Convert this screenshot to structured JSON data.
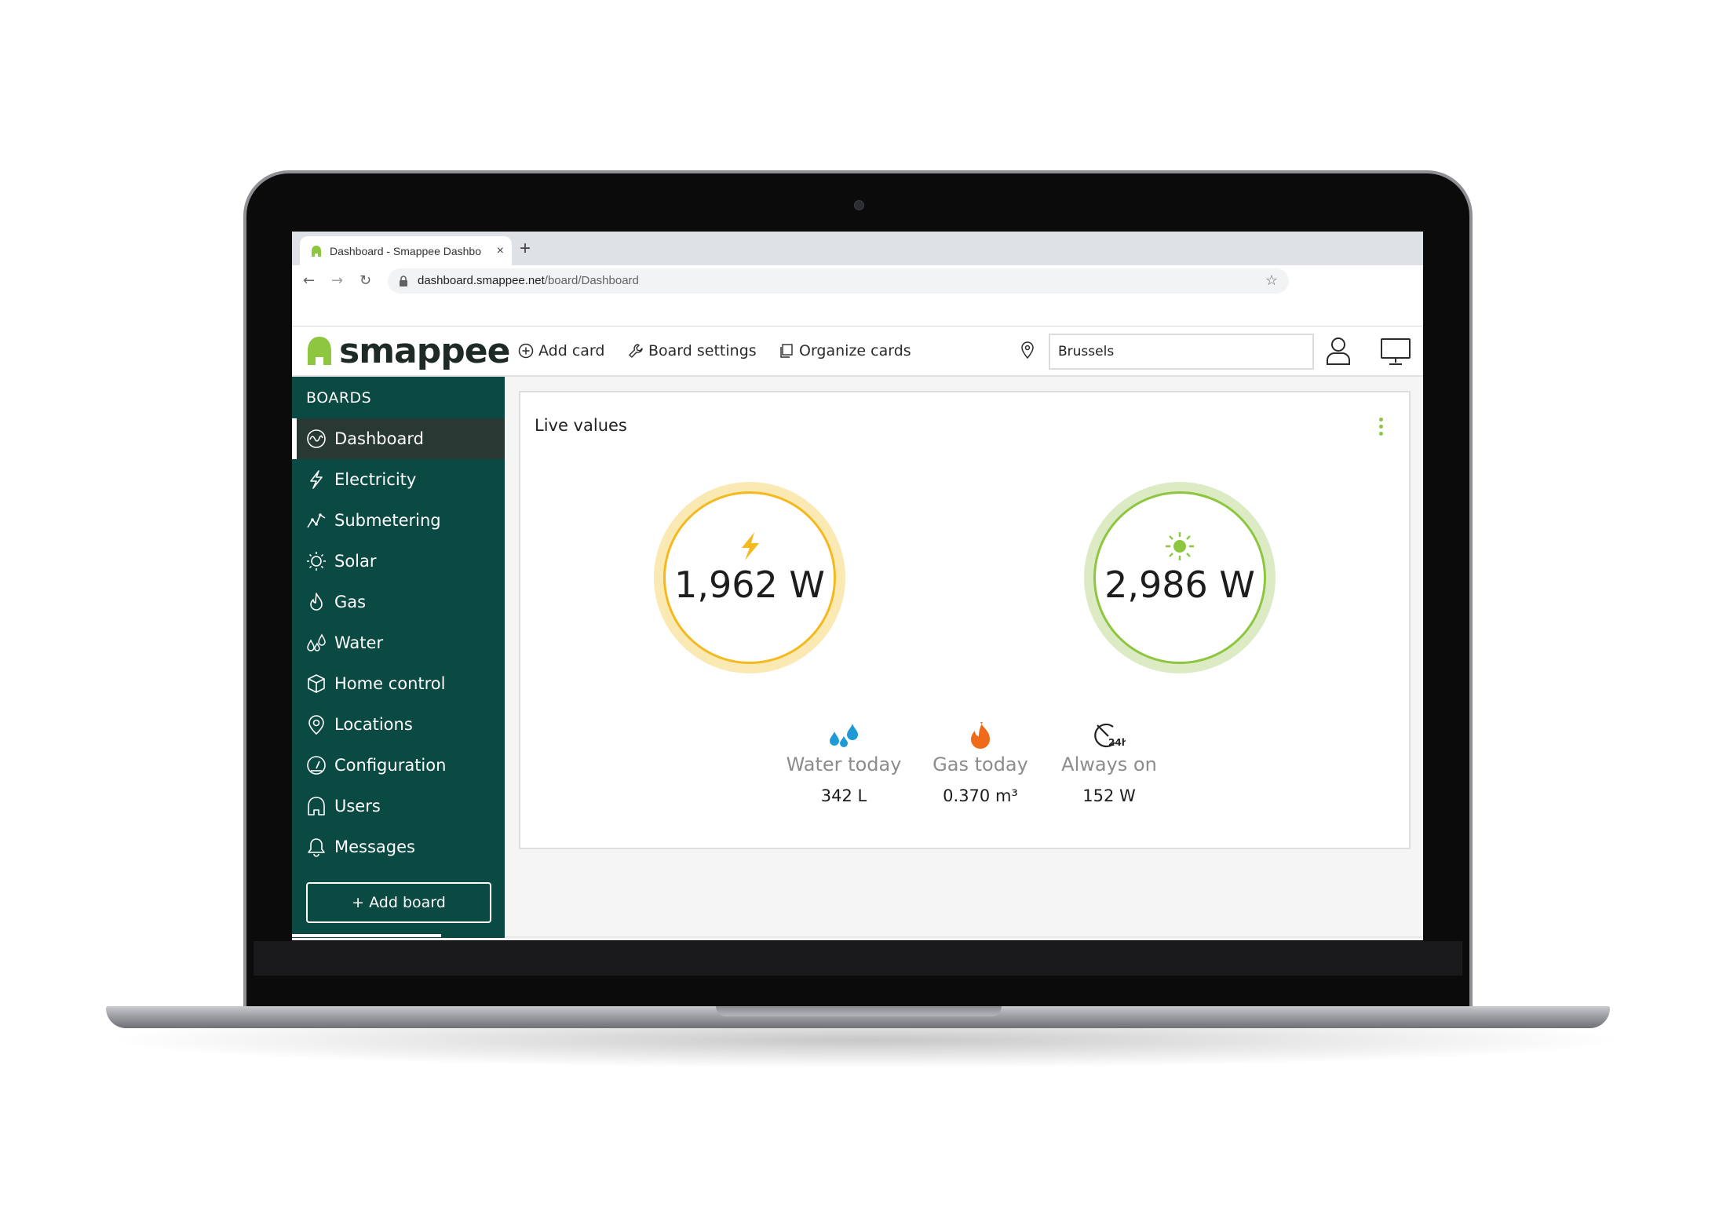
{
  "browser": {
    "tab_title": "Dashboard - Smappee Dashbo",
    "new_tab": "+",
    "close": "×",
    "url_host": "dashboard.smappee.net",
    "url_path": "/board/Dashboard"
  },
  "header": {
    "logo_text": "smappee",
    "add_card": "Add card",
    "board_settings": "Board settings",
    "organize_cards": "Organize cards",
    "location_value": "Brussels"
  },
  "sidebar": {
    "title": "BOARDS",
    "items": [
      {
        "label": "Dashboard",
        "icon": "pulse-icon",
        "active": true
      },
      {
        "label": "Electricity",
        "icon": "lightning-icon"
      },
      {
        "label": "Submetering",
        "icon": "graph-icon"
      },
      {
        "label": "Solar",
        "icon": "sun-icon"
      },
      {
        "label": "Gas",
        "icon": "flame-icon"
      },
      {
        "label": "Water",
        "icon": "water-drops-icon"
      },
      {
        "label": "Home control",
        "icon": "cube-icon"
      },
      {
        "label": "Locations",
        "icon": "location-pin-icon"
      },
      {
        "label": "Configuration",
        "icon": "gauge-icon"
      },
      {
        "label": "Users",
        "icon": "house-icon"
      },
      {
        "label": "Messages",
        "icon": "bell-icon"
      }
    ],
    "add_board": "+ Add board"
  },
  "card": {
    "title": "Live values",
    "consumption": {
      "value": "1,962 W",
      "color": "#f5b920",
      "icon": "lightning-icon"
    },
    "solar": {
      "value": "2,986 W",
      "color": "#8dc63f",
      "icon": "sun-icon"
    },
    "stats": [
      {
        "label": "Water today",
        "value": "342 L",
        "icon": "water-drops-icon",
        "color": "#1e9ad6"
      },
      {
        "label": "Gas today",
        "value": "0.370 m³",
        "icon": "flame-icon",
        "color": "#ef6a1a"
      },
      {
        "label": "Always on",
        "value": "152 W",
        "icon": "always-on-24h-icon",
        "color": "#222222"
      }
    ]
  },
  "colors": {
    "sidebar": "#0a4a43",
    "sidebar_active": "#283833",
    "accent": "#8dc63f"
  }
}
